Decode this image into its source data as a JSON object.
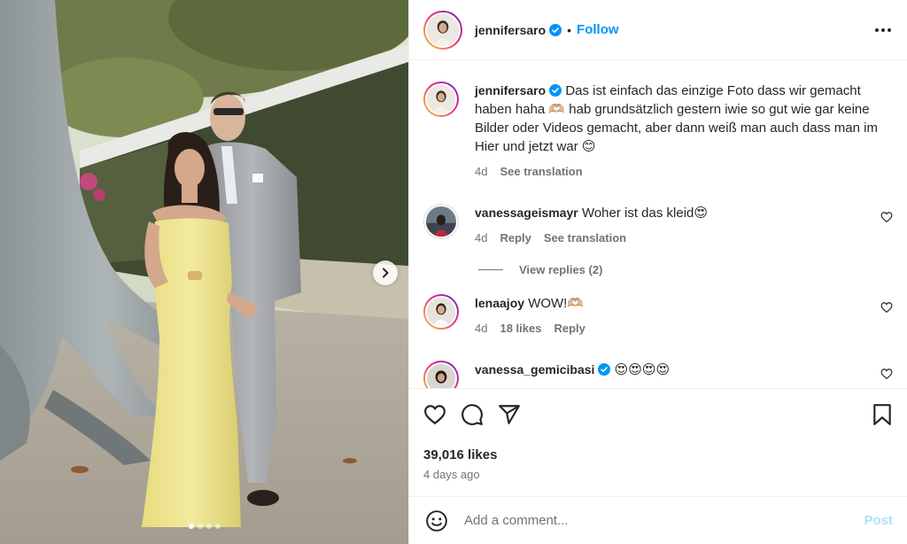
{
  "post": {
    "author": "jennifersaro",
    "follow_label": "Follow",
    "separator": "•"
  },
  "caption": {
    "username": "jennifersaro",
    "text": "Das ist einfach das einzige Foto dass wir gemacht haben haha 🫶🏼 hab grundsätzlich gestern iwie so gut wie gar keine Bilder oder Videos gemacht, aber dann weiß man auch dass man im Hier und jetzt war 😊",
    "time": "4d",
    "translate_label": "See translation"
  },
  "comments": [
    {
      "username": "vanessageismayr",
      "text": "Woher ist das kleid😍",
      "time": "4d",
      "reply_label": "Reply",
      "translate_label": "See translation",
      "view_replies": "View replies (2)"
    },
    {
      "username": "lenaajoy",
      "text": "WOW!🫶🏼",
      "time": "4d",
      "likes": "18 likes",
      "reply_label": "Reply"
    },
    {
      "username": "vanessa_gemicibasi",
      "text": "😍😍😍😍"
    }
  ],
  "stats": {
    "likes": "39,016 likes",
    "date": "4 days ago"
  },
  "composer": {
    "placeholder": "Add a comment...",
    "post_label": "Post"
  },
  "carousel": {
    "current": 1,
    "total": 4
  },
  "icons": {
    "verified": "verified-badge-icon",
    "more": "more-options-icon",
    "like": "heart-icon",
    "comment": "comment-icon",
    "share": "share-icon",
    "save": "bookmark-icon",
    "emoji": "emoji-icon",
    "next": "chevron-right-icon"
  },
  "colors": {
    "accent": "#0095f6",
    "post_disabled": "#b2dffc",
    "muted": "#737373"
  }
}
